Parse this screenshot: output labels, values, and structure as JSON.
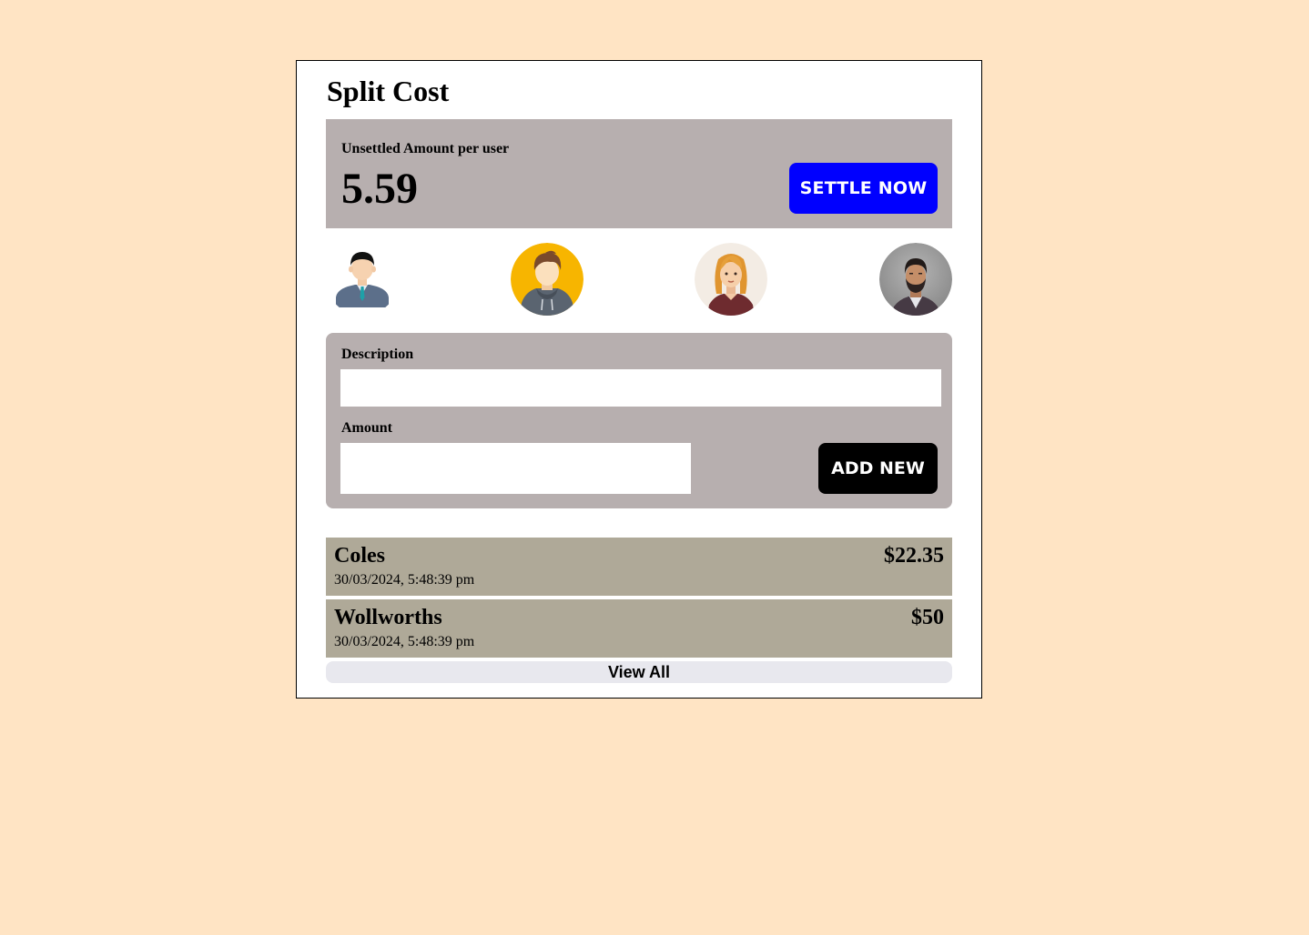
{
  "app": {
    "title": "Split Cost"
  },
  "summary": {
    "label": "Unsettled Amount per user",
    "amount": "5.59",
    "settle_button_label": "SETTLE NOW"
  },
  "users": [
    {
      "avatar": "businessman-avatar-icon"
    },
    {
      "avatar": "hoodie-man-avatar-icon"
    },
    {
      "avatar": "woman-avatar-icon"
    },
    {
      "avatar": "bearded-man-photo-avatar"
    }
  ],
  "form": {
    "description_label": "Description",
    "description_value": "",
    "amount_label": "Amount",
    "amount_value": "",
    "add_button_label": "ADD NEW"
  },
  "expenses": [
    {
      "name": "Coles",
      "amount": "$22.35",
      "date": "30/03/2024, 5:48:39 pm"
    },
    {
      "name": "Wollworths",
      "amount": "$50",
      "date": "30/03/2024, 5:48:39 pm"
    }
  ],
  "view_all_label": "View All",
  "colors": {
    "page_background": "#ffe4c4",
    "panel_background": "#b7afaf",
    "expense_background": "#afa998",
    "settle_button": "#0000ff",
    "add_button": "#000000",
    "view_all_background": "#e8e8ee"
  }
}
